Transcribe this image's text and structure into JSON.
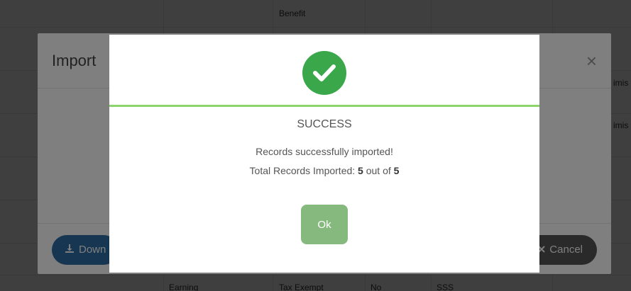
{
  "background_table": {
    "top_cell": "Benefit",
    "right_fragments": [
      "imis",
      "imis"
    ],
    "bottom_row": [
      "Earning",
      "Tax Exempt",
      "No",
      "SSS"
    ]
  },
  "import_modal": {
    "title": "Import",
    "close_glyph": "×",
    "download_label": "Down",
    "download_icon": "download-icon",
    "cancel_label": "Cancel",
    "cancel_icon": "close-icon"
  },
  "success_dialog": {
    "title": "SUCCESS",
    "message": "Records successfully imported!",
    "total_prefix": "Total Records Imported: ",
    "imported_count": "5",
    "out_of_text": " out of ",
    "total_count": "5",
    "ok_label": "Ok",
    "icon": "check-circle-icon",
    "accent_color": "#3aa84a",
    "divider_color": "#8cd46b"
  }
}
